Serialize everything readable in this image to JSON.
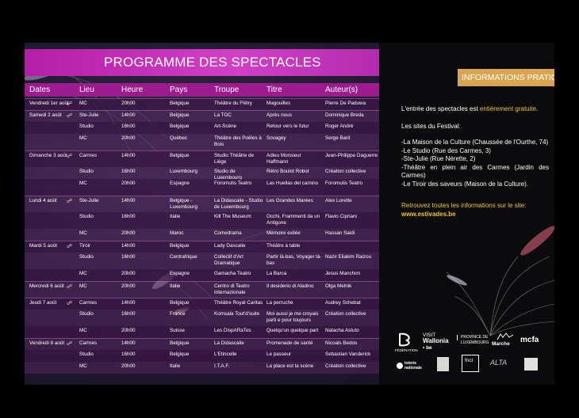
{
  "title": "PROGRAMME DES SPECTACLES",
  "headers": [
    "Dates",
    "Lieu",
    "Heure",
    "Pays",
    "Troupe",
    "Titre",
    "Auteur(s)"
  ],
  "rows": [
    {
      "date": "Vendredi 1er août",
      "lieu": "MC",
      "heure": "20h00",
      "pays": "Belgique",
      "troupe": "Théâtre du Flêtry",
      "titre": "Magouilles",
      "auteur": "Pierre De Paduwa"
    },
    {
      "date": "Samedi 2 août",
      "lieu": "Ste-Julie",
      "heure": "14h00",
      "pays": "Belgique",
      "troupe": "La TOC",
      "titre": "Après nous",
      "auteur": "Dominique Breda"
    },
    {
      "date": "",
      "lieu": "Studio",
      "heure": "16h00",
      "pays": "Belgique",
      "troupe": "Art-Scène",
      "titre": "Retour vers le futur",
      "auteur": "Roger André"
    },
    {
      "date": "",
      "lieu": "MC",
      "heure": "20h00",
      "pays": "Québec",
      "troupe": "Théâtre des Poêles à Bois",
      "titre": "Sovagey",
      "auteur": "Serge Baril"
    },
    {
      "date": "Dimanche 3 août",
      "lieu": "Carmes",
      "heure": "14h00",
      "pays": "Belgique",
      "troupe": "Studio Théâtre de Liège",
      "titre": "Adieu Monsieur Haffmann",
      "auteur": "Jean-Philippe Daguerre"
    },
    {
      "date": "",
      "lieu": "Studio",
      "heure": "16h00",
      "pays": "Luxembourg",
      "troupe": "Studio de Luxembourg",
      "titre": "Rétro Boulot Robot",
      "auteur": "Création collective"
    },
    {
      "date": "",
      "lieu": "MC",
      "heure": "20h00",
      "pays": "Espagne",
      "troupe": "Foromutis Teatro",
      "titre": "Las Huellas del camino",
      "auteur": "Foromutis Teatro"
    },
    {
      "date": "Lundi 4 août",
      "lieu": "Ste-Julie",
      "heure": "14h00",
      "pays": "Belgique - Luxembourg",
      "troupe": "La Didascalie - Studio de Luxembourg",
      "titre": "Les Grandes Marées",
      "auteur": "Alex Lorette"
    },
    {
      "date": "",
      "lieu": "Studio",
      "heure": "16h00",
      "pays": "Italie",
      "troupe": "Kill The Museum",
      "titre": "Occhi, Frammenti da un Antigone",
      "auteur": "Flavio Cipriani"
    },
    {
      "date": "",
      "lieu": "MC",
      "heure": "20h00",
      "pays": "Maroc",
      "troupe": "Comedrama",
      "titre": "Mémoire exilée",
      "auteur": "Hassan Saidi"
    },
    {
      "date": "Mardi 5 août",
      "lieu": "Tiroir",
      "heure": "14h00",
      "pays": "Belgique",
      "troupe": "Lady Dascalie",
      "titre": "Théâtre à table",
      "auteur": ""
    },
    {
      "date": "",
      "lieu": "Studio",
      "heure": "16h00",
      "pays": "Centrafrique",
      "troupe": "Collectif d'Art Dramatique",
      "titre": "Partir là-bas, Voyager là-bas",
      "auteur": "Nazir Eliakim Raizou"
    },
    {
      "date": "",
      "lieu": "MC",
      "heure": "20h00",
      "pays": "Espagne",
      "troupe": "Gamacha Teatro",
      "titre": "La Barca",
      "auteur": "Jesus Manchon"
    },
    {
      "date": "Mercredi 6 août",
      "lieu": "MC",
      "heure": "20h00",
      "pays": "Italie",
      "troupe": "Centro di Teatro Internazionale",
      "titre": "Il desiderio di Aladino",
      "auteur": "Olga Melnik"
    },
    {
      "date": "Jeudi 7 août",
      "lieu": "Carmes",
      "heure": "14h00",
      "pays": "Belgique",
      "troupe": "Théâtre Royal Caritas",
      "titre": "La perruche",
      "auteur": "Audrey Schebat"
    },
    {
      "date": "",
      "lieu": "Studio",
      "heure": "16h00",
      "pays": "France",
      "troupe": "Komsala Tout'd'suite",
      "titre": "Moi aussi je me croyais parti e pour toujours",
      "auteur": "Création collective"
    },
    {
      "date": "",
      "lieu": "MC",
      "heure": "20h00",
      "pays": "Suisse",
      "troupe": "Les DispARaTes",
      "titre": "Quelqu'un quelque part",
      "auteur": "Natacha Astuto"
    },
    {
      "date": "Vendredi 8 août",
      "lieu": "Carmes",
      "heure": "14h00",
      "pays": "Belgique",
      "troupe": "La Didascalie",
      "titre": "Promenade de santé",
      "auteur": "Nicoals Bedos"
    },
    {
      "date": "",
      "lieu": "Studio",
      "heure": "16h00",
      "pays": "Belgique",
      "troupe": "L'Etincelle",
      "titre": "Le passeur",
      "auteur": "Sebastian Vanderick"
    },
    {
      "date": "",
      "lieu": "MC",
      "heure": "20h00",
      "pays": "Italie",
      "troupe": "I.T.A.F.",
      "titre": "La place est la scène",
      "auteur": "Création collective"
    }
  ],
  "info": {
    "button": "INFORMATIONS PRATIQUES",
    "entry_prefix": "L'entrée des spectacles est ",
    "entry_highlight": "entièrement gratuite",
    "entry_suffix": ".",
    "sites_title": "Les sites du Festival:",
    "sites": [
      "-La Maison de la Culture (Chaussée de l'Ourthe, 74)",
      "-Le Studio (Rue des Carmes, 3)",
      "-Ste-Julie (Rue Nérette, 2)",
      "-Théâtre en plein air des Carmes (Jardin des Carmes)",
      "-Le Tiroir des saveurs (Maison de la Culture)."
    ],
    "more": "Retrouvez toutes les informations sur le site:",
    "url": "www.estivades.be"
  },
  "logos": {
    "federation": "FÉDÉRATION",
    "visit": "VISIT",
    "wallonia": "Wallonia",
    "be": "• be",
    "province_1": "PROVINCE DE",
    "province_2": "LUXEMBOURG",
    "marche": "Marche",
    "mcfa": "mcfa",
    "loterie_1": "loterie",
    "loterie_2": "nationale",
    "alta": "ALTA",
    "fnctl": "fncl"
  },
  "colors": {
    "accent": "#c02cb6",
    "header_row": "#9c1c90",
    "info_button": "#d9a550",
    "highlight": "#f0c52a"
  }
}
